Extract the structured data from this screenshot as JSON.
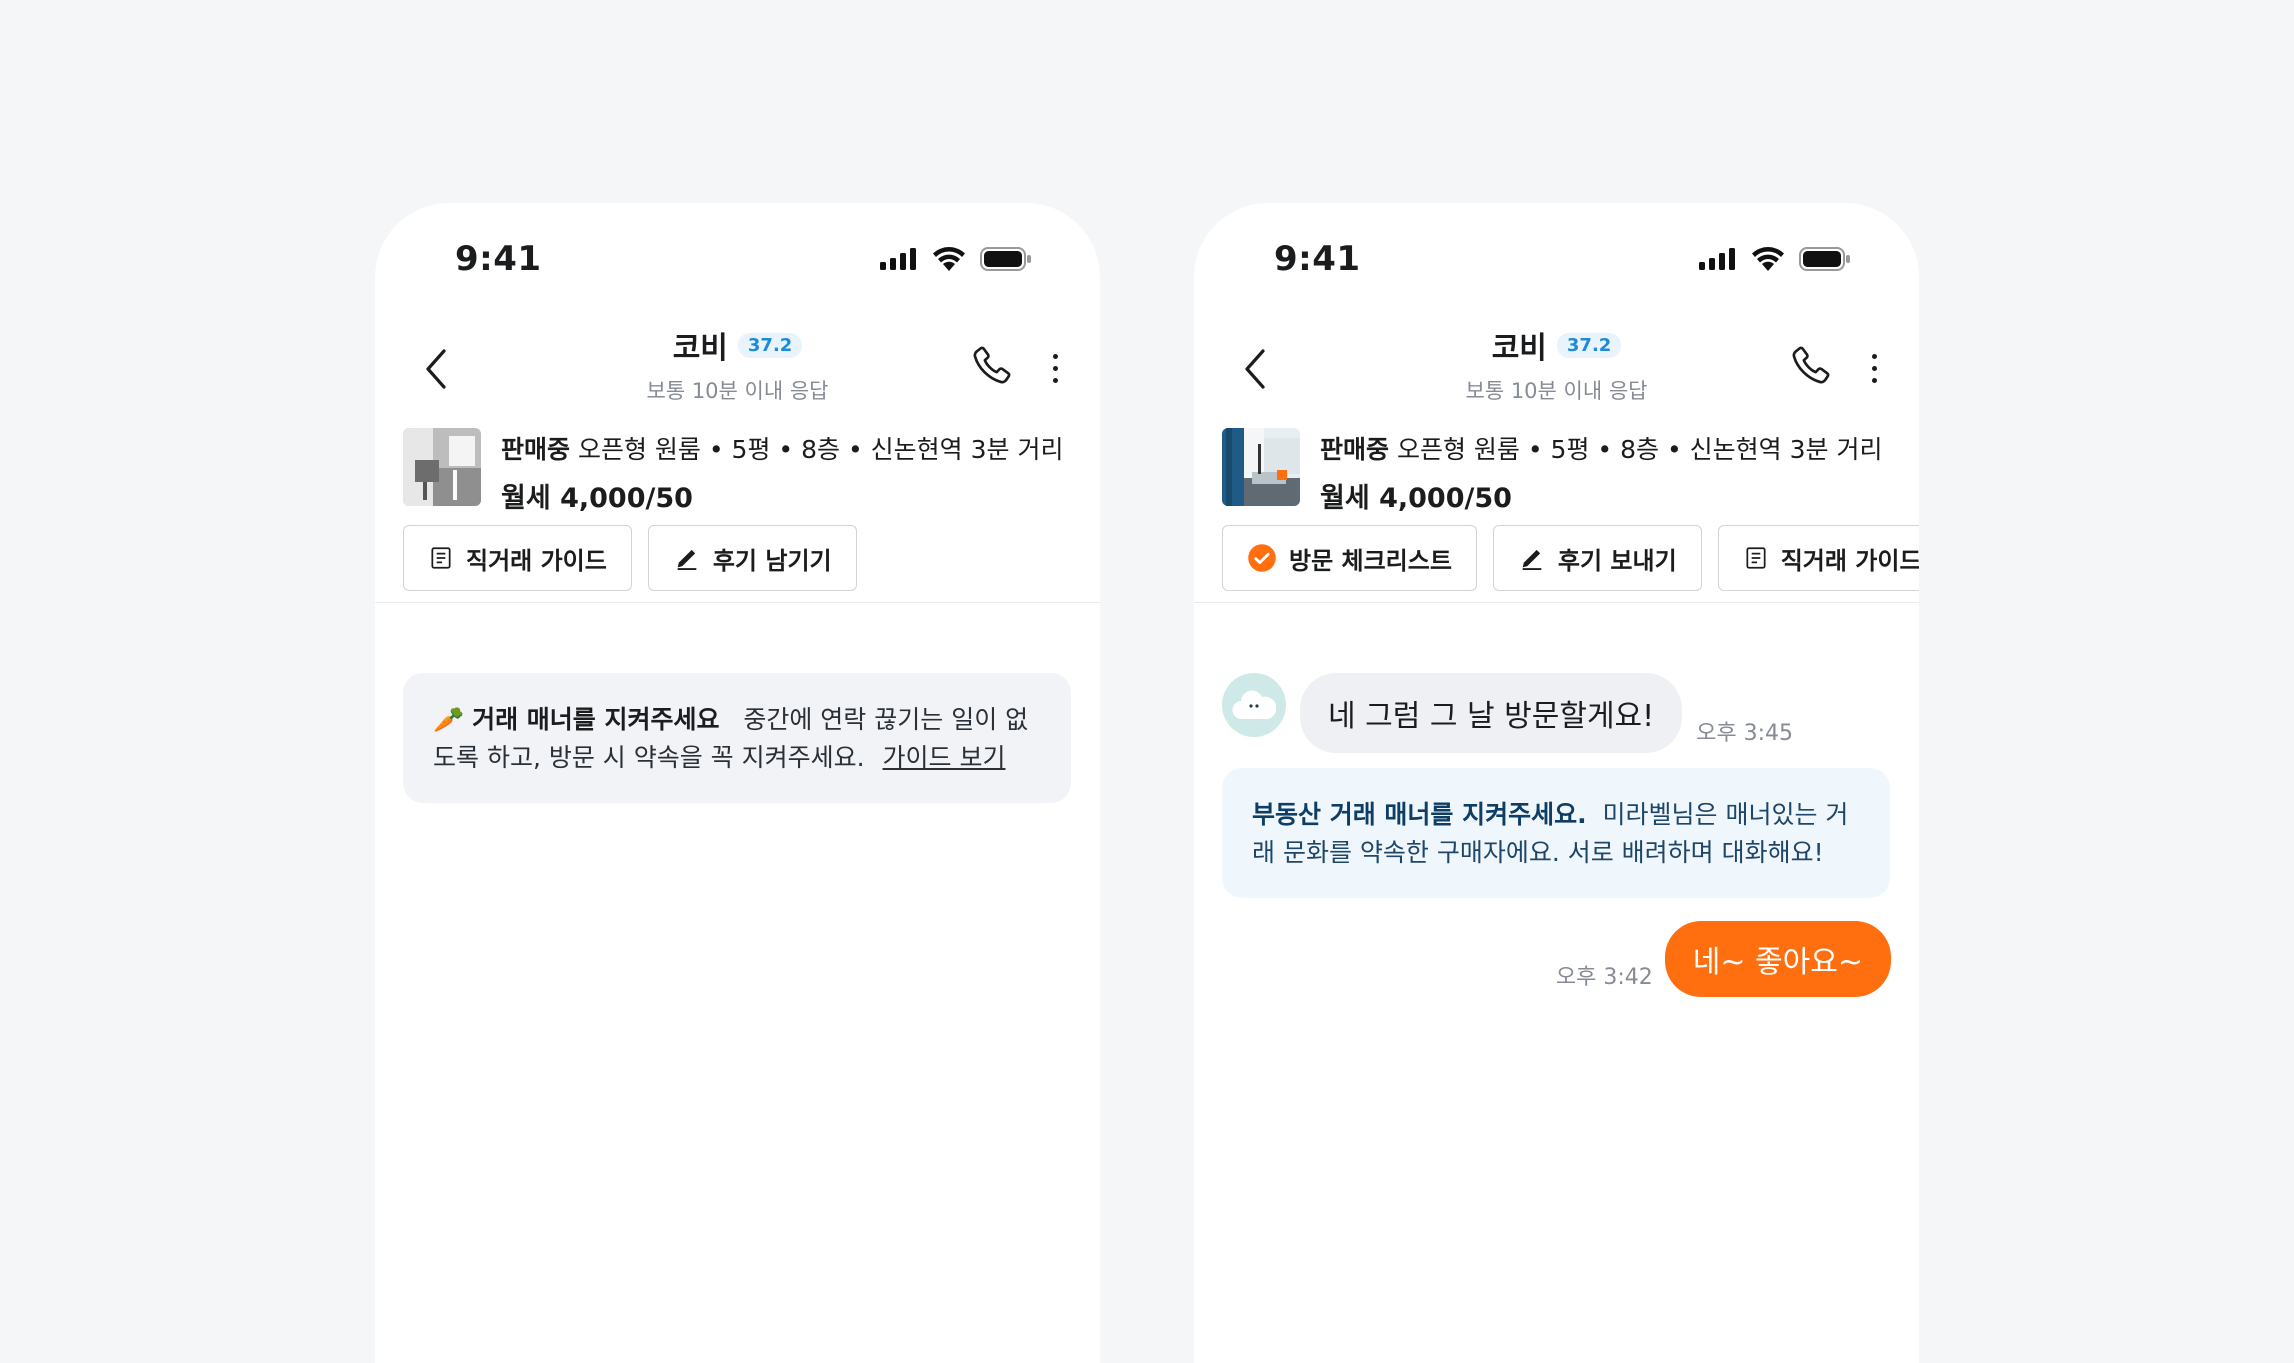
{
  "left": {
    "status_time": "9:41",
    "header": {
      "name": "코비",
      "temperature": "37.2",
      "subtitle": "보통 10분 이내 응답"
    },
    "listing": {
      "status": "판매중",
      "description": "오픈형 원룸 • 5평 • 8층 • 신논현역 3분 거리",
      "price": "월세 4,000/50"
    },
    "chips": [
      {
        "label": "직거래 가이드",
        "icon": "document-icon"
      },
      {
        "label": "후기 남기기",
        "icon": "pencil-icon"
      }
    ],
    "notice": {
      "emoji": "🥕",
      "title": "거래 매너를 지켜주세요",
      "body": "중간에 연락 끊기는 일이 없도록 하고, 방문 시 약속을 꼭 지켜주세요.",
      "link": "가이드 보기"
    }
  },
  "right": {
    "status_time": "9:41",
    "header": {
      "name": "코비",
      "temperature": "37.2",
      "subtitle": "보통 10분 이내 응답"
    },
    "listing": {
      "status": "판매중",
      "description": "오픈형 원룸 • 5평 • 8층 • 신논현역 3분 거리",
      "price": "월세 4,000/50"
    },
    "chips": [
      {
        "label": "방문 체크리스트",
        "icon": "check-circle-icon"
      },
      {
        "label": "후기 보내기",
        "icon": "pencil-icon"
      },
      {
        "label": "직거래 가이드",
        "icon": "document-icon"
      }
    ],
    "messages": {
      "incoming": {
        "text": "네 그럼 그 날 방문할게요!",
        "time": "오후 3:45"
      },
      "info": {
        "title": "부동산 거래 매너를 지켜주세요.",
        "body": "미라벨님은 매너있는 거래 문화를 약속한 구매자에요. 서로 배려하며 대화해요!"
      },
      "outgoing": {
        "text": "네~ 좋아요~",
        "time": "오후 3:42"
      }
    }
  },
  "colors": {
    "accent": "#ff6f0f",
    "temperature": "#1c8bd8",
    "info_bg": "#f0f7fc"
  }
}
